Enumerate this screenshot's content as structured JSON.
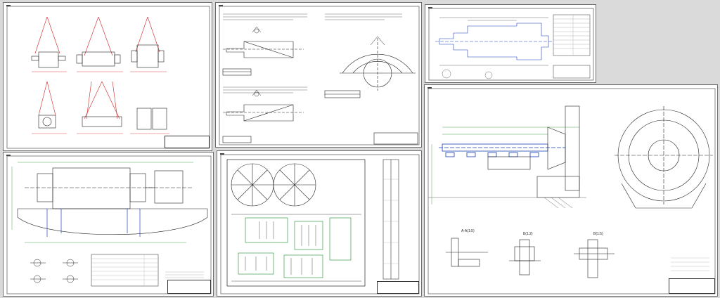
{
  "viewer": {
    "background": "#dadada",
    "line_color": "#1a1a1a",
    "accent_colors": {
      "section_red": "#d02020",
      "shaft_blue": "#1b3fb8",
      "dim_green": "#1b8a2b"
    }
  },
  "sheets": [
    {
      "id": "lifting-schemes",
      "tag": "",
      "stamp": ""
    },
    {
      "id": "alignment-schemes",
      "tag": "",
      "stamp": ""
    },
    {
      "id": "shaft-part",
      "tag": "",
      "stamp": ""
    },
    {
      "id": "mill-installation",
      "tag": "",
      "stamp": ""
    },
    {
      "id": "shop-layout",
      "tag": "",
      "stamp": ""
    },
    {
      "id": "mill-assembly-detail",
      "tag": "",
      "stamp": ""
    }
  ],
  "detail_labels": {
    "a": "А-А(1:5)",
    "b": "Б(1:2)",
    "c": "В(1:5)"
  }
}
